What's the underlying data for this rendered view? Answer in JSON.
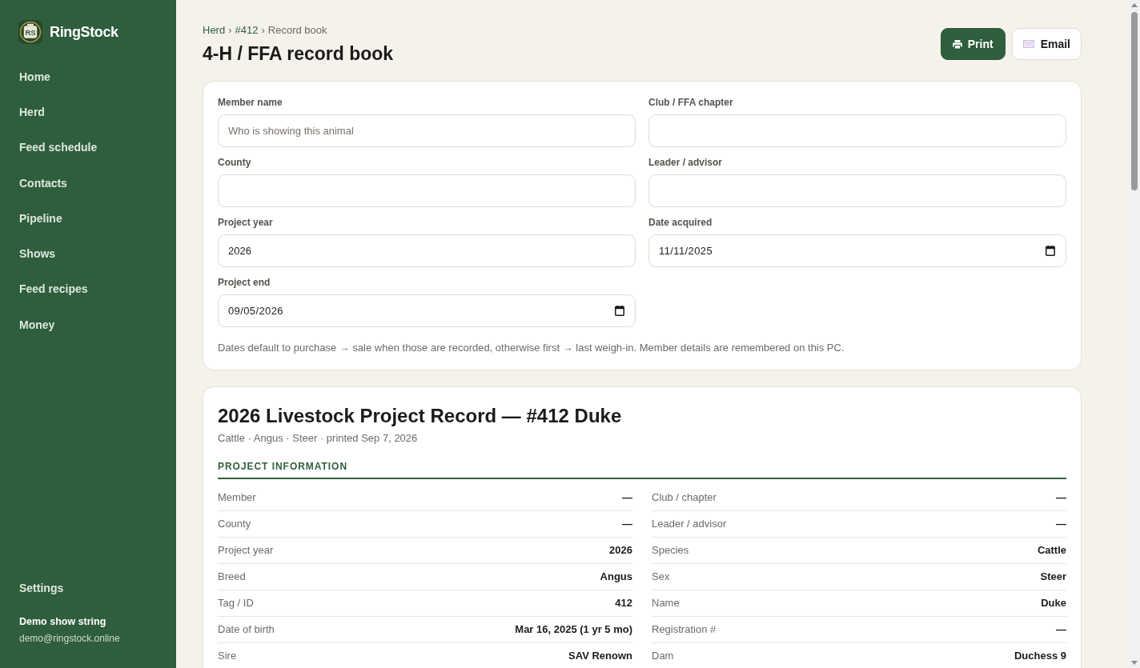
{
  "app": {
    "name": "RingStock",
    "logo_text": "RS"
  },
  "sidebar": {
    "items": [
      {
        "label": "Home"
      },
      {
        "label": "Herd"
      },
      {
        "label": "Feed schedule"
      },
      {
        "label": "Contacts"
      },
      {
        "label": "Pipeline"
      },
      {
        "label": "Shows"
      },
      {
        "label": "Feed recipes"
      },
      {
        "label": "Money"
      }
    ],
    "settings": "Settings",
    "account": {
      "name": "Demo show string",
      "email": "demo@ringstock.online"
    }
  },
  "breadcrumb": [
    {
      "label": "Herd",
      "kind": "link"
    },
    {
      "label": "›",
      "kind": "separator"
    },
    {
      "label": "#412",
      "kind": "link"
    },
    {
      "label": "›",
      "kind": "separator"
    },
    {
      "label": "Record book",
      "kind": "current"
    }
  ],
  "page_title": "4-H / FFA record book",
  "actions": [
    {
      "label": "Print",
      "kind": "primary"
    },
    {
      "label": "Email",
      "kind": "secondary"
    }
  ],
  "form": {
    "fields": [
      {
        "label": "Member name",
        "kind": "text",
        "placeholder": "Who is showing this animal"
      },
      {
        "label": "Club / FFA chapter",
        "kind": "text"
      },
      {
        "label": "County",
        "kind": "text"
      },
      {
        "label": "Leader / advisor",
        "kind": "text"
      },
      {
        "label": "Project year",
        "kind": "text",
        "value": "2026"
      },
      {
        "label": "Date acquired",
        "kind": "date",
        "value": "11/11/2025"
      },
      {
        "label": "Project end",
        "kind": "date",
        "value": "09/05/2026"
      }
    ],
    "note": "Dates default to purchase → sale when those are recorded, otherwise first → last weigh-in. Member details are remembered on this PC."
  },
  "record": {
    "title": "2026 Livestock Project Record — #412 Duke",
    "subtitle": "Cattle · Angus · Steer · printed Sep 7, 2026",
    "section": {
      "title": "PROJECT INFORMATION",
      "left": [
        {
          "label": "Member",
          "value": "—"
        },
        {
          "label": "County",
          "value": "—"
        },
        {
          "label": "Project year",
          "value": "2026"
        },
        {
          "label": "Breed",
          "value": "Angus"
        },
        {
          "label": "Tag / ID",
          "value": "412"
        },
        {
          "label": "Date of birth",
          "value": "Mar 16, 2025 (1 yr 5 mo)"
        },
        {
          "label": "Sire",
          "value": "SAV Renown"
        }
      ],
      "right": [
        {
          "label": "Club / chapter",
          "value": "—"
        },
        {
          "label": "Leader / advisor",
          "value": "—"
        },
        {
          "label": "Species",
          "value": "Cattle"
        },
        {
          "label": "Sex",
          "value": "Steer"
        },
        {
          "label": "Name",
          "value": "Duke"
        },
        {
          "label": "Registration #",
          "value": "—"
        },
        {
          "label": "Dam",
          "value": "Duchess 9"
        }
      ]
    }
  }
}
